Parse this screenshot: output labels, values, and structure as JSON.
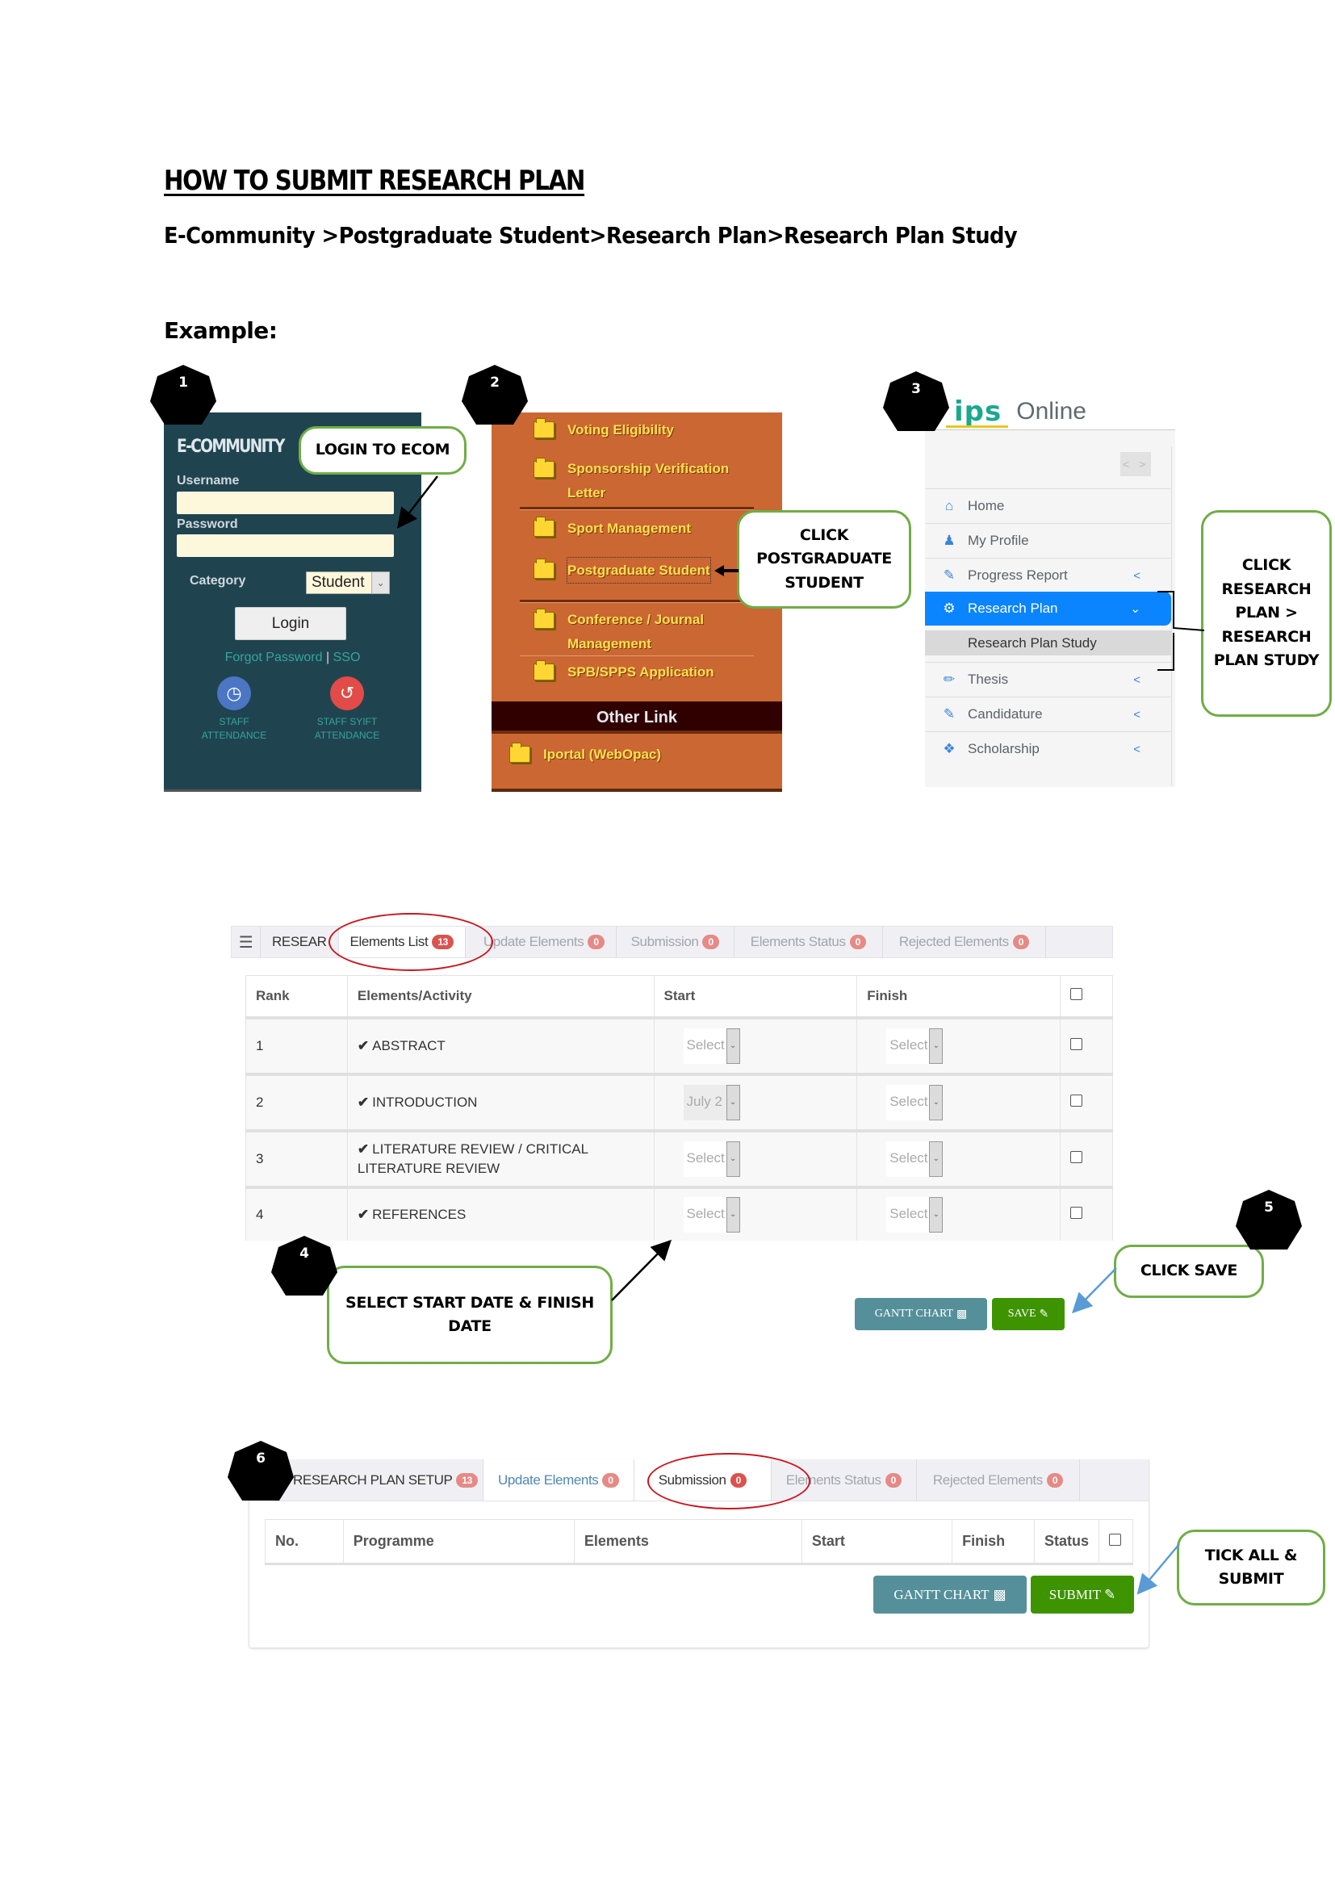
{
  "document": {
    "title": "HOW TO SUBMIT RESEARCH PLAN",
    "navigation_path": "E-Community >Postgraduate Student>Research Plan>Research Plan Study",
    "example_label": "Example:"
  },
  "steps": {
    "s1": {
      "badge": "1",
      "callout": "LOGIN TO ECOM",
      "panel": {
        "brand": "E-COMMUNITY",
        "username_label": "Username",
        "username_value": "",
        "password_label": "Password",
        "password_value": "",
        "category_label": "Category",
        "category_value": "Student",
        "login_button": "Login",
        "forgot_password_link": "Forgot Password",
        "separator": "|",
        "sso_link": "SSO",
        "staff_attendance": "STAFF ATTENDANCE",
        "staff_syift_attendance": "STAFF SYIFT ATTENDANCE"
      }
    },
    "s2": {
      "badge": "2",
      "callout": "CLICK POSTGRADUATE STUDENT",
      "menu_items": [
        "Voting Eligibility",
        "Sponsorship Verification Letter",
        "Sport Management",
        "Postgraduate Student",
        "Conference / Journal Management",
        "SPB/SPPS Application"
      ],
      "other_link_header": "Other Link",
      "other_links": [
        "Iportal (WebOpac)"
      ]
    },
    "s3": {
      "badge": "3",
      "callout": "CLICK RESEARCH PLAN > RESEARCH PLAN STUDY",
      "logo_text": "ips",
      "logo_suffix": "Online",
      "toggle": "< >",
      "menu": [
        {
          "label": "Home",
          "icon": "home-icon"
        },
        {
          "label": "My Profile",
          "icon": "user-icon"
        },
        {
          "label": "Progress Report",
          "icon": "edit-icon"
        },
        {
          "label": "Research Plan",
          "icon": "gear-icon"
        },
        {
          "label": "Research Plan Study"
        },
        {
          "label": "Thesis",
          "icon": "pencil-icon"
        },
        {
          "label": "Candidature",
          "icon": "edit-icon"
        },
        {
          "label": "Scholarship",
          "icon": "ticket-icon"
        }
      ]
    },
    "s4": {
      "badge": "4",
      "callout": "SELECT START DATE & FINISH DATE"
    },
    "s5": {
      "badge": "5",
      "callout": "CLICK SAVE"
    },
    "s6": {
      "badge": "6",
      "callout": "TICK ALL & SUBMIT"
    }
  },
  "elements_view": {
    "tabs": [
      {
        "label": "RESEAR",
        "count": null
      },
      {
        "label": "Elements List",
        "count": "13"
      },
      {
        "label": "Update Elements",
        "count": "0"
      },
      {
        "label": "Submission",
        "count": "0"
      },
      {
        "label": "Elements Status",
        "count": "0"
      },
      {
        "label": "Rejected Elements",
        "count": "0"
      }
    ],
    "columns": [
      "Rank",
      "Elements/Activity",
      "Start",
      "Finish"
    ],
    "rows": [
      {
        "rank": "1",
        "element": "ABSTRACT",
        "start": "Select",
        "finish": "Select"
      },
      {
        "rank": "2",
        "element": "INTRODUCTION",
        "start": "July 2",
        "finish": "Select"
      },
      {
        "rank": "3",
        "element": "LITERATURE REVIEW / CRITICAL LITERATURE REVIEW",
        "start": "Select",
        "finish": "Select"
      },
      {
        "rank": "4",
        "element": "REFERENCES",
        "start": "Select",
        "finish": "Select"
      }
    ],
    "check_glyph": "✔",
    "gantt_button": "GANTT CHART",
    "save_button": "SAVE"
  },
  "submission_view": {
    "tabs": [
      {
        "label": "RESEARCH PLAN SETUP",
        "count": "13"
      },
      {
        "label": "Update Elements",
        "count": "0"
      },
      {
        "label": "Submission",
        "count": "0"
      },
      {
        "label": "Elements Status",
        "count": "0"
      },
      {
        "label": "Rejected Elements",
        "count": "0"
      }
    ],
    "columns": [
      "No.",
      "Programme",
      "Elements",
      "Start",
      "Finish",
      "Status"
    ],
    "gantt_button": "GANTT CHART",
    "submit_button": "SUBMIT"
  },
  "colors": {
    "callout_border": "#70ad47",
    "highlight_ellipse": "#c8161d",
    "save_green": "#3e9400",
    "gantt_teal": "#55909a",
    "badge_red": "#d9534f",
    "ecom_panel": "#1f4450",
    "menu_orange": "#cb6733",
    "ips_active": "#0a84ff"
  }
}
